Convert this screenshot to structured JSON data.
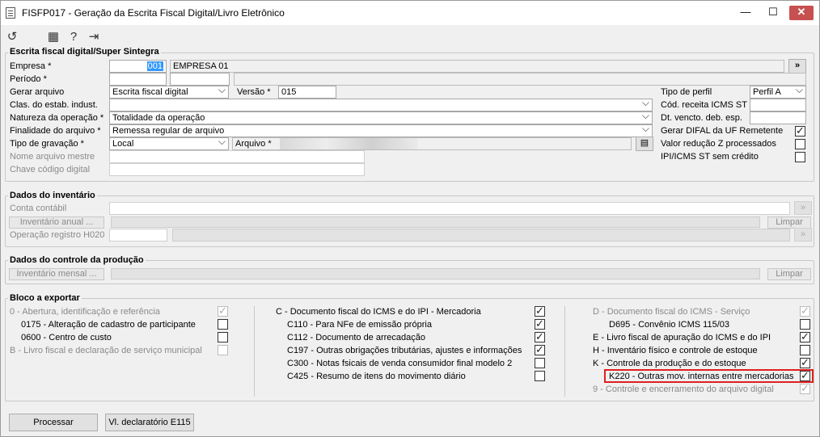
{
  "window": {
    "title": "FISFP017 - Geração da Escrita Fiscal Digital/Livro Eletrônico",
    "close_glyph": "✕"
  },
  "toolbar": {
    "icons": [
      "refresh-icon",
      "calendar-icon",
      "help-icon",
      "exit-icon"
    ]
  },
  "escrita": {
    "section_title": "Escrita fiscal digital/Super Sintegra",
    "empresa_label": "Empresa *",
    "empresa_code": "001",
    "empresa_name": "EMPRESA 01",
    "empresa_btn": "»",
    "periodo_label": "Período *",
    "gerar_label": "Gerar arquivo",
    "gerar_value": "Escrita fiscal digital",
    "versao_label": "Versão *",
    "versao_value": "015",
    "clas_label": "Clas. do estab. indust.",
    "natureza_label": "Natureza da operação *",
    "natureza_value": "Totalidade da operação",
    "finalidade_label": "Finalidade do arquivo *",
    "finalidade_value": "Remessa regular de arquivo",
    "tipo_grav_label": "Tipo de gravação *",
    "tipo_grav_value": "Local",
    "arquivo_label": "Arquivo *",
    "nome_mestre_label": "Nome arquivo mestre",
    "chave_label": "Chave código digital",
    "tipo_perfil_label": "Tipo de perfil",
    "tipo_perfil_value": "Perfil A",
    "cod_receita_label": "Cód. receita ICMS ST",
    "dt_vencto_label": "Dt. vencto. deb. esp.",
    "difal_label": "Gerar DIFAL da UF Remetente",
    "difal_checked": true,
    "reducao_label": "Valor redução Z processados",
    "reducao_checked": false,
    "ipi_label": "IPI/ICMS ST sem crédito",
    "ipi_checked": false
  },
  "inventario": {
    "section_title": "Dados do inventário",
    "conta_label": "Conta contábil",
    "inventario_btn": "Inventário anual ...",
    "limpar_btn": "Limpar",
    "operacao_label": "Operação registro H020"
  },
  "producao": {
    "section_title": "Dados do controle da produção",
    "inventario_btn": "Inventário mensal ...",
    "limpar_btn": "Limpar"
  },
  "bloco": {
    "section_title": "Bloco a exportar",
    "col1": [
      {
        "label": "0 - Abertura, identificação e referência",
        "checked": true,
        "disabled": true
      },
      {
        "label": "0175 - Alteração de cadastro de participante",
        "checked": false,
        "disabled": false
      },
      {
        "label": "0600 - Centro de custo",
        "checked": false,
        "disabled": false
      },
      {
        "label": "B - Livro fiscal e declaração de serviço municipal",
        "checked": false,
        "disabled": true
      }
    ],
    "col2": [
      {
        "label": "C - Documento fiscal do ICMS e do IPI - Mercadoria",
        "checked": true,
        "disabled": false
      },
      {
        "label": "C110 - Para NFe de emissão própria",
        "checked": true,
        "disabled": false
      },
      {
        "label": "C112 - Documento de arrecadação",
        "checked": true,
        "disabled": false
      },
      {
        "label": "C197 - Outras obrigações tributárias, ajustes e informações",
        "checked": true,
        "disabled": false
      },
      {
        "label": "C300 - Notas fsicais de venda consumidor final modelo 2",
        "checked": false,
        "disabled": false
      },
      {
        "label": "C425 - Resumo de itens do movimento diário",
        "checked": false,
        "disabled": false
      }
    ],
    "col3": [
      {
        "label": "D - Documento fiscal do ICMS - Serviço",
        "checked": true,
        "disabled": true
      },
      {
        "label": "D695 - Convênio ICMS 115/03",
        "checked": false,
        "disabled": false
      },
      {
        "label": "E - Livro fiscal de apuração do ICMS e do IPI",
        "checked": true,
        "disabled": false
      },
      {
        "label": "H - Inventário físico e controle de estoque",
        "checked": false,
        "disabled": false
      },
      {
        "label": "K - Controle da produção e do estoque",
        "checked": true,
        "disabled": false
      },
      {
        "label": "K220 - Outras mov. internas entre mercadorias",
        "checked": true,
        "disabled": false
      },
      {
        "label": "9 - Controle e encerramento do arquivo digital",
        "checked": true,
        "disabled": true
      }
    ]
  },
  "footer": {
    "processar_btn": "Processar",
    "declaratorio_btn": "Vl. declaratório E115"
  }
}
